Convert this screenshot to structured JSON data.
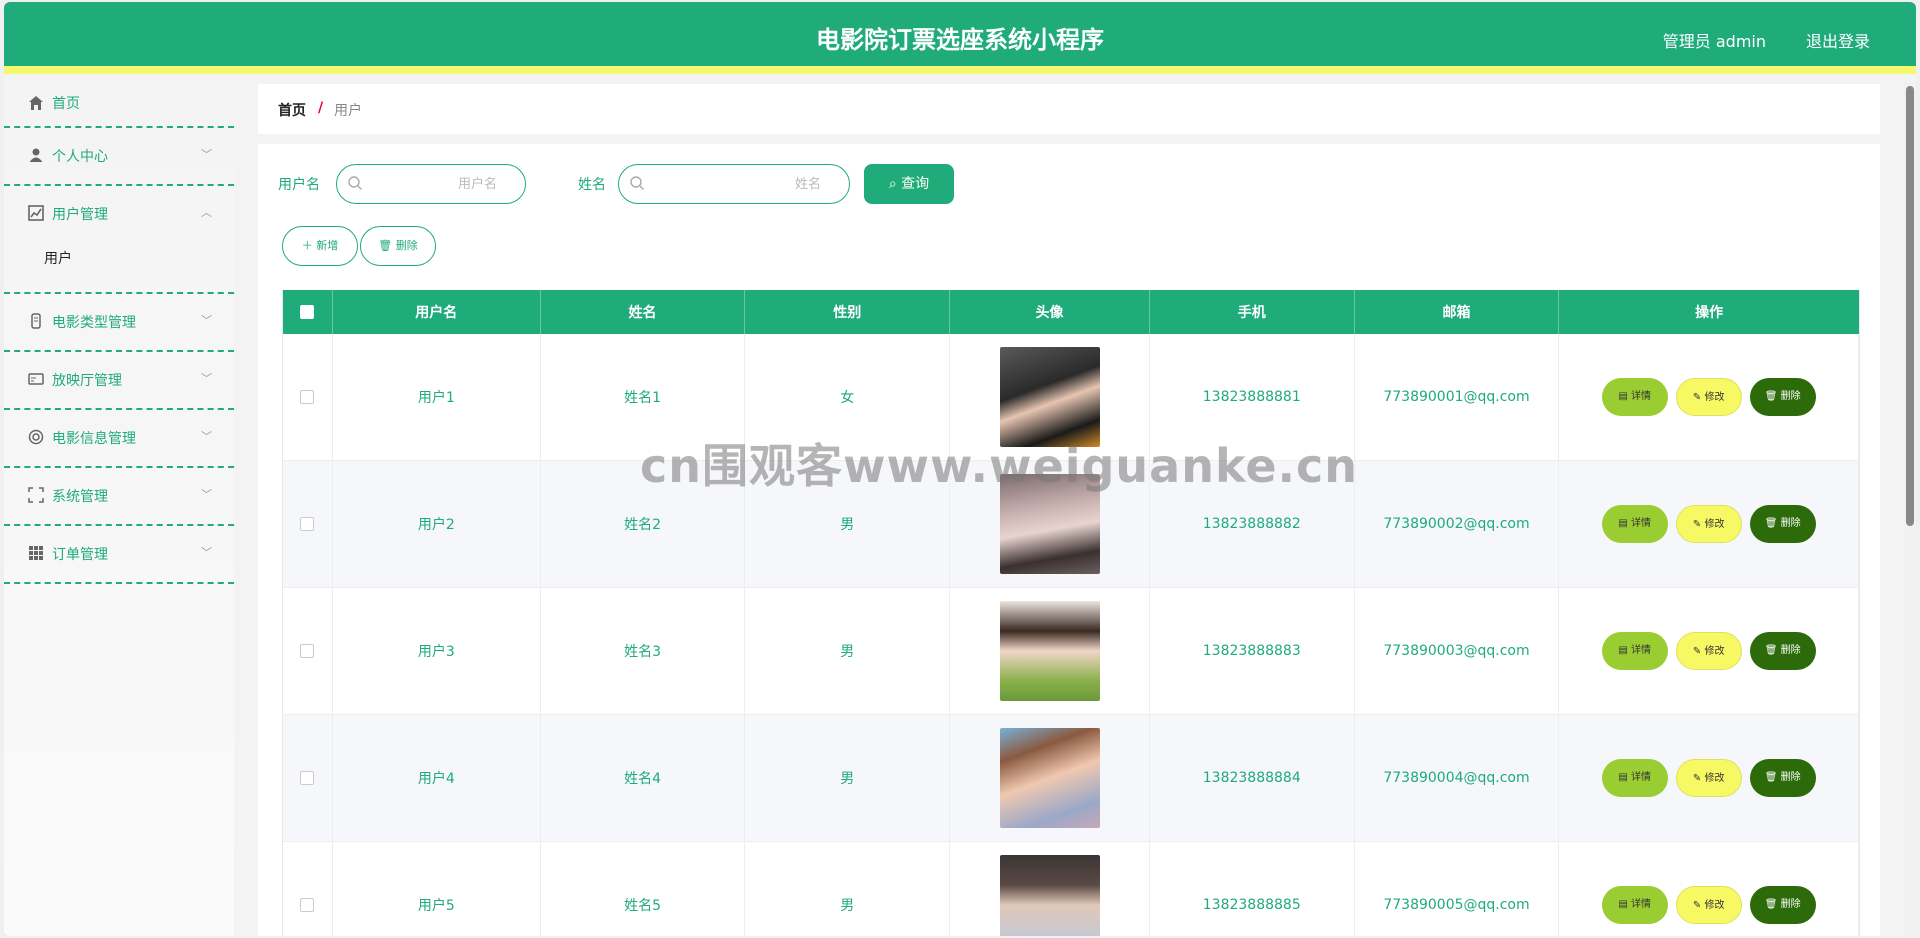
{
  "header": {
    "title": "电影院订票选座系统小程序",
    "user_label": "管理员 admin",
    "logout_label": "退出登录"
  },
  "sidebar": {
    "items": [
      {
        "label": "首页",
        "icon": "home-icon"
      },
      {
        "label": "个人中心",
        "icon": "person-icon"
      },
      {
        "label": "用户管理",
        "icon": "chart-icon",
        "sub": [
          "用户"
        ]
      },
      {
        "label": "电影类型管理",
        "icon": "film-icon"
      },
      {
        "label": "放映厅管理",
        "icon": "card-icon"
      },
      {
        "label": "电影信息管理",
        "icon": "ring-icon"
      },
      {
        "label": "系统管理",
        "icon": "fullscreen-icon"
      },
      {
        "label": "订单管理",
        "icon": "grid-icon"
      }
    ]
  },
  "breadcrumb": {
    "home": "首页",
    "separator": "/",
    "current": "用户"
  },
  "search": {
    "username_label": "用户名",
    "username_placeholder": "用户名",
    "name_label": "姓名",
    "name_placeholder": "姓名",
    "query_label": "查询"
  },
  "actions": {
    "add_label": "新增",
    "delete_label": "删除"
  },
  "table": {
    "headers": [
      "用户名",
      "姓名",
      "性别",
      "头像",
      "手机",
      "邮箱",
      "操作"
    ],
    "rows": [
      {
        "username": "用户1",
        "name": "姓名1",
        "gender": "女",
        "phone": "13823888881",
        "email": "773890001@qq.com"
      },
      {
        "username": "用户2",
        "name": "姓名2",
        "gender": "男",
        "phone": "13823888882",
        "email": "773890002@qq.com"
      },
      {
        "username": "用户3",
        "name": "姓名3",
        "gender": "男",
        "phone": "13823888883",
        "email": "773890003@qq.com"
      },
      {
        "username": "用户4",
        "name": "姓名4",
        "gender": "男",
        "phone": "13823888884",
        "email": "773890004@qq.com"
      },
      {
        "username": "用户5",
        "name": "姓名5",
        "gender": "男",
        "phone": "13823888885",
        "email": "773890005@qq.com"
      }
    ],
    "row_actions": {
      "detail": "详情",
      "edit": "修改",
      "delete": "删除"
    }
  },
  "watermark": "cn围观客www.weiguanke.cn",
  "colors": {
    "primary": "#1fab7a",
    "accent": "#f5f770",
    "detail": "#9acd32",
    "edit": "#f7f964",
    "delete": "#2c6a0a"
  }
}
